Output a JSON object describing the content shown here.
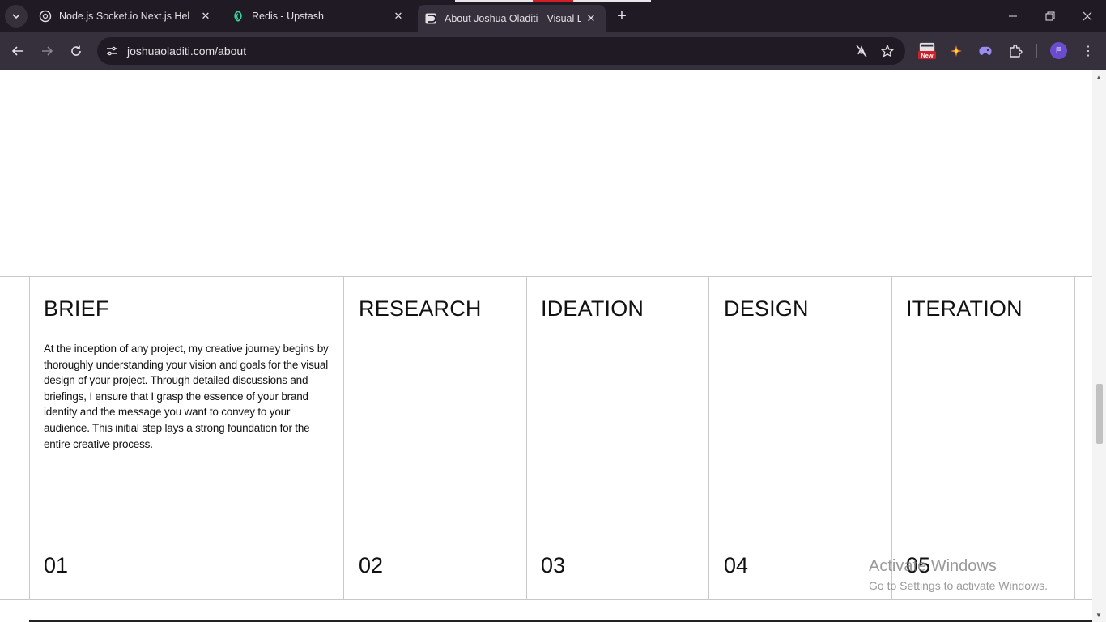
{
  "browser": {
    "tabs": [
      {
        "title": "Node.js Socket.io Next.js Help",
        "favicon": "openai-icon",
        "active": false
      },
      {
        "title": "Redis - Upstash",
        "favicon": "upstash-icon",
        "active": false
      },
      {
        "title": "About Joshua Oladiti - Visual D",
        "favicon": "site-icon",
        "active": true
      }
    ],
    "url": "joshuaoladiti.com/about",
    "extension_badge": "New",
    "profile_initial": "E",
    "colors": {
      "tabbar": "#1f1a24",
      "toolbar": "#35303b",
      "avatar": "#6a4ccf"
    }
  },
  "page": {
    "columns": [
      {
        "title": "BRIEF",
        "body": "At the inception of any project, my creative journey begins by thoroughly understanding your vision and goals for the visual design of your project. Through detailed discussions and briefings, I ensure that I grasp the essence of your brand identity and the message you want to convey to your audience. This initial step lays a strong foundation for the entire creative process.",
        "number": "01"
      },
      {
        "title": "RESEARCH",
        "number": "02"
      },
      {
        "title": "IDEATION",
        "number": "03"
      },
      {
        "title": "DESIGN",
        "number": "04"
      },
      {
        "title": "ITERATION",
        "number": "05"
      }
    ]
  },
  "watermark": {
    "line1": "Activate Windows",
    "line2": "Go to Settings to activate Windows."
  }
}
